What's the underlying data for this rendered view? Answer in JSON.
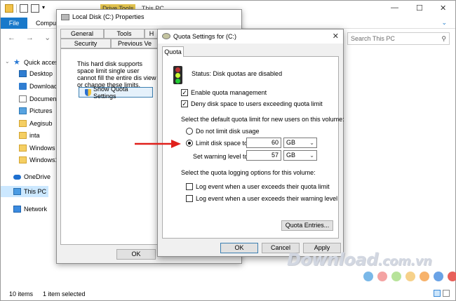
{
  "explorer": {
    "title_tab": "Drive Tools",
    "title": "This PC",
    "ribbon": {
      "file": "File",
      "computer": "Comput"
    },
    "search_placeholder": "Search This PC",
    "nav": {
      "quick_access": "Quick acces",
      "items": [
        "Desktop",
        "Download",
        "Document",
        "Pictures",
        "Aegisub",
        "inta",
        "Windows 1",
        "Windows1"
      ],
      "onedrive": "OneDrive",
      "this_pc": "This PC",
      "network": "Network"
    },
    "status": {
      "count": "10 items",
      "selected": "1 item selected"
    }
  },
  "properties": {
    "title": "Local Disk (C:) Properties",
    "tabs_row1": [
      "General",
      "Tools",
      "H"
    ],
    "tabs_row2": [
      "Security",
      "Previous Ve"
    ],
    "description": "This hard disk supports space limit single user cannot fill the entire dis view or change these limits.",
    "show_quota_button": "Show Quota Settings",
    "ok_button": "OK"
  },
  "quota": {
    "title": "Quota Settings for  (C:)",
    "tab": "Quota",
    "status": "Status:  Disk quotas are disabled",
    "enable_management": {
      "label": "Enable quota management",
      "checked": true
    },
    "deny_space": {
      "label": "Deny disk space to users exceeding quota limit",
      "checked": true
    },
    "default_limit_heading": "Select the default quota limit for new users on this volume:",
    "no_limit_label": "Do not limit disk usage",
    "limit_label": "Limit disk space to",
    "limit_value": "60",
    "limit_unit": "GB",
    "warning_label": "Set warning level to",
    "warning_value": "57",
    "warning_unit": "GB",
    "logging_heading": "Select the quota logging options for this volume:",
    "log_limit": {
      "label": "Log event when a user exceeds their quota limit",
      "checked": false
    },
    "log_warning": {
      "label": "Log event when a user exceeds their warning level",
      "checked": false
    },
    "entries_button": "Quota Entries...",
    "ok_button": "OK",
    "cancel_button": "Cancel",
    "apply_button": "Apply"
  },
  "watermark": {
    "text": "Download",
    "suffix": ".com.vn"
  },
  "colors": {
    "accent": "#1979ca",
    "arrow": "#e0201b",
    "dots": [
      "#7ab8e8",
      "#f4a3a3",
      "#b7e39a",
      "#f6d18a",
      "#f7b26b",
      "#6aa3e6",
      "#e8605a"
    ]
  }
}
